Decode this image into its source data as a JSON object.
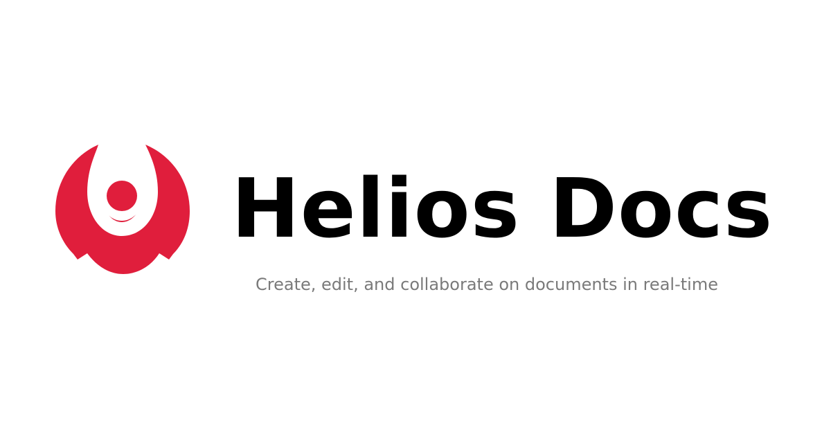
{
  "brand": {
    "name": "Helios Docs",
    "tagline": "Create, edit, and collaborate on documents in real-time",
    "logo_icon": "helios-flame-logo-icon"
  },
  "colors": {
    "logo": "#e01e3c",
    "title": "#000000",
    "tagline": "#7a7a7a",
    "background": "#ffffff"
  }
}
